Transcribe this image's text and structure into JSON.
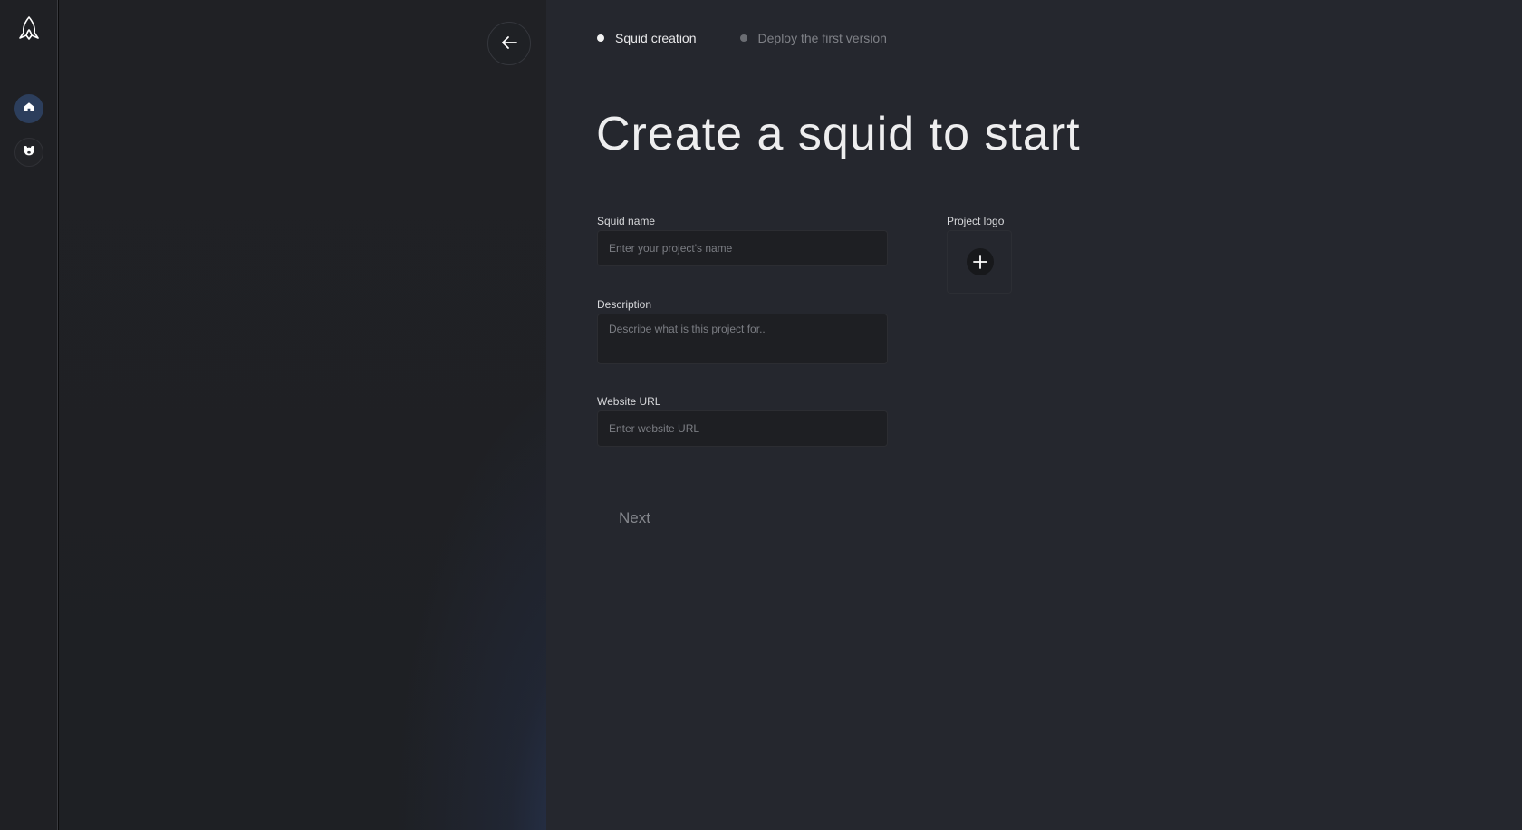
{
  "rail": {
    "logo_icon": "squid-logo-icon",
    "items": [
      {
        "icon": "home-icon",
        "active": true
      },
      {
        "icon": "bear-icon",
        "active": false
      }
    ]
  },
  "panel": {
    "back_icon": "arrow-left-icon"
  },
  "steps": [
    {
      "label": "Squid creation",
      "active": true
    },
    {
      "label": "Deploy the first version",
      "active": false
    }
  ],
  "title": "Create a squid to start",
  "form": {
    "squid_name": {
      "label": "Squid name",
      "placeholder": "Enter your project's name",
      "value": ""
    },
    "description": {
      "label": "Description",
      "placeholder": "Describe what is this project for..",
      "value": ""
    },
    "website": {
      "label": "Website URL",
      "placeholder": "Enter website URL",
      "value": ""
    },
    "project_logo": {
      "label": "Project logo",
      "icon": "plus-icon"
    }
  },
  "next_label": "Next",
  "colors": {
    "main_bg": "#25272e",
    "panel_bg": "#1f2024",
    "accent_home": "#2c3e5c",
    "text_primary": "#eeeeef",
    "text_muted": "#7f8187"
  }
}
